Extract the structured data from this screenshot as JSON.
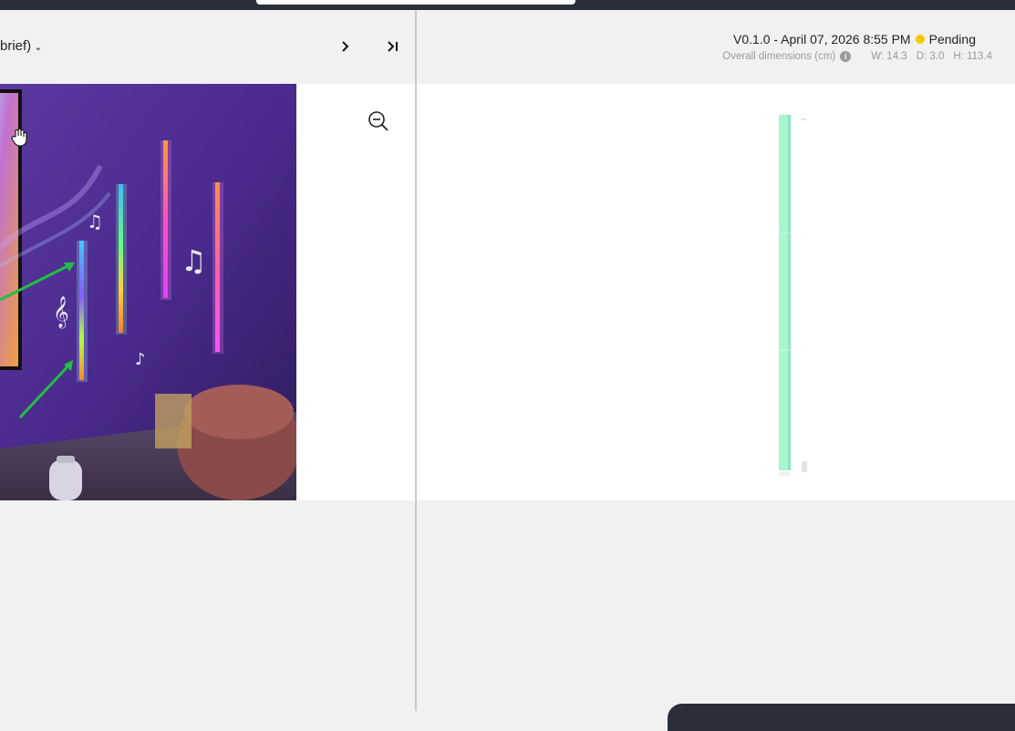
{
  "left_header": {
    "brief_dropdown_label": "brief)"
  },
  "right_header": {
    "version": "V0.1.0 - April 07, 2026 8:55 PM",
    "status": "Pending",
    "dimensions_label": "Overall dimensions (cm)",
    "width": "W: 14.3",
    "depth": "D: 3.0",
    "height": "H: 113.4"
  },
  "colors": {
    "status_pending": "#f5c800",
    "model_bar": "#a8f5d0"
  },
  "icons": [
    "chevron-down-icon",
    "chevron-right-icon",
    "skip-to-last-icon",
    "zoom-out-icon",
    "info-icon",
    "hand-cursor-icon"
  ]
}
